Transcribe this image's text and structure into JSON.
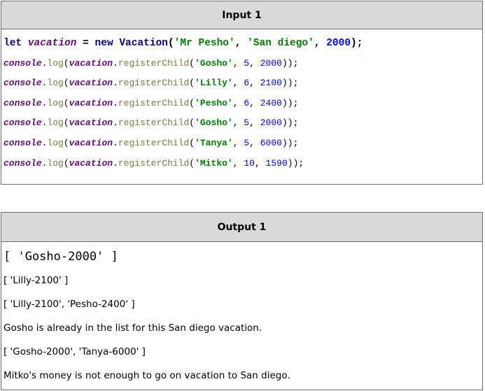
{
  "input": {
    "title": "Input 1",
    "lines": [
      [
        {
          "t": "let ",
          "c": "kw"
        },
        {
          "t": "vacation",
          "c": "var"
        },
        {
          "t": " = ",
          "c": "plain"
        },
        {
          "t": "new ",
          "c": "kw"
        },
        {
          "t": "Vacation",
          "c": "cls"
        },
        {
          "t": "(",
          "c": "plain"
        },
        {
          "t": "'Mr Pesho'",
          "c": "str"
        },
        {
          "t": ", ",
          "c": "plain"
        },
        {
          "t": "'San diego'",
          "c": "str"
        },
        {
          "t": ", ",
          "c": "plain"
        },
        {
          "t": "2000",
          "c": "num"
        },
        {
          "t": ");",
          "c": "plain"
        }
      ],
      [
        {
          "t": "console",
          "c": "var"
        },
        {
          "t": ".",
          "c": "plain"
        },
        {
          "t": "log",
          "c": "method"
        },
        {
          "t": "(",
          "c": "plain"
        },
        {
          "t": "vacation",
          "c": "var"
        },
        {
          "t": ".",
          "c": "plain"
        },
        {
          "t": "registerChild",
          "c": "method"
        },
        {
          "t": "(",
          "c": "plain"
        },
        {
          "t": "'Gosho'",
          "c": "str"
        },
        {
          "t": ", ",
          "c": "plain"
        },
        {
          "t": "5",
          "c": "num"
        },
        {
          "t": ", ",
          "c": "plain"
        },
        {
          "t": "2000",
          "c": "num"
        },
        {
          "t": "));",
          "c": "plain"
        }
      ],
      [
        {
          "t": "console",
          "c": "var"
        },
        {
          "t": ".",
          "c": "plain"
        },
        {
          "t": "log",
          "c": "method"
        },
        {
          "t": "(",
          "c": "plain"
        },
        {
          "t": "vacation",
          "c": "var"
        },
        {
          "t": ".",
          "c": "plain"
        },
        {
          "t": "registerChild",
          "c": "method"
        },
        {
          "t": "(",
          "c": "plain"
        },
        {
          "t": "'Lilly'",
          "c": "str"
        },
        {
          "t": ", ",
          "c": "plain"
        },
        {
          "t": "6",
          "c": "num"
        },
        {
          "t": ", ",
          "c": "plain"
        },
        {
          "t": "2100",
          "c": "num"
        },
        {
          "t": "));",
          "c": "plain"
        }
      ],
      [
        {
          "t": "console",
          "c": "var"
        },
        {
          "t": ".",
          "c": "plain"
        },
        {
          "t": "log",
          "c": "method"
        },
        {
          "t": "(",
          "c": "plain"
        },
        {
          "t": "vacation",
          "c": "var"
        },
        {
          "t": ".",
          "c": "plain"
        },
        {
          "t": "registerChild",
          "c": "method"
        },
        {
          "t": "(",
          "c": "plain"
        },
        {
          "t": "'Pesho'",
          "c": "str"
        },
        {
          "t": ", ",
          "c": "plain"
        },
        {
          "t": "6",
          "c": "num"
        },
        {
          "t": ", ",
          "c": "plain"
        },
        {
          "t": "2400",
          "c": "num"
        },
        {
          "t": "));",
          "c": "plain"
        }
      ],
      [
        {
          "t": "console",
          "c": "var"
        },
        {
          "t": ".",
          "c": "plain"
        },
        {
          "t": "log",
          "c": "method"
        },
        {
          "t": "(",
          "c": "plain"
        },
        {
          "t": "vacation",
          "c": "var"
        },
        {
          "t": ".",
          "c": "plain"
        },
        {
          "t": "registerChild",
          "c": "method"
        },
        {
          "t": "(",
          "c": "plain"
        },
        {
          "t": "'Gosho'",
          "c": "str"
        },
        {
          "t": ", ",
          "c": "plain"
        },
        {
          "t": "5",
          "c": "num"
        },
        {
          "t": ", ",
          "c": "plain"
        },
        {
          "t": "2000",
          "c": "num"
        },
        {
          "t": "));",
          "c": "plain"
        }
      ],
      [
        {
          "t": "console",
          "c": "var"
        },
        {
          "t": ".",
          "c": "plain"
        },
        {
          "t": "log",
          "c": "method"
        },
        {
          "t": "(",
          "c": "plain"
        },
        {
          "t": "vacation",
          "c": "var"
        },
        {
          "t": ".",
          "c": "plain"
        },
        {
          "t": "registerChild",
          "c": "method"
        },
        {
          "t": "(",
          "c": "plain"
        },
        {
          "t": "'Tanya'",
          "c": "str"
        },
        {
          "t": ", ",
          "c": "plain"
        },
        {
          "t": "5",
          "c": "num"
        },
        {
          "t": ", ",
          "c": "plain"
        },
        {
          "t": "6000",
          "c": "num"
        },
        {
          "t": "));",
          "c": "plain"
        }
      ],
      [
        {
          "t": "console",
          "c": "var"
        },
        {
          "t": ".",
          "c": "plain"
        },
        {
          "t": "log",
          "c": "method"
        },
        {
          "t": "(",
          "c": "plain"
        },
        {
          "t": "vacation",
          "c": "var"
        },
        {
          "t": ".",
          "c": "plain"
        },
        {
          "t": "registerChild",
          "c": "method"
        },
        {
          "t": "(",
          "c": "plain"
        },
        {
          "t": "'Mitko'",
          "c": "str"
        },
        {
          "t": ", ",
          "c": "plain"
        },
        {
          "t": "10",
          "c": "num"
        },
        {
          "t": ", ",
          "c": "plain"
        },
        {
          "t": "1590",
          "c": "num"
        },
        {
          "t": "));",
          "c": "plain"
        }
      ]
    ]
  },
  "output": {
    "title": "Output 1",
    "lines": [
      "[ 'Gosho-2000' ]",
      "[ 'Lilly-2100' ]",
      "[ 'Lilly-2100', 'Pesho-2400' ]",
      "Gosho is already in the list for this San diego vacation.",
      "[ 'Gosho-2000', 'Tanya-6000' ]",
      "Mitko's money is not enough to go on vacation to San diego."
    ]
  },
  "colors": {
    "header_bg": "#d9d9d9",
    "border": "#6f6f6f",
    "keyword": "#000080",
    "variable": "#660e7a",
    "string": "#008000",
    "number": "#0000ff",
    "method": "#7a7a43"
  }
}
